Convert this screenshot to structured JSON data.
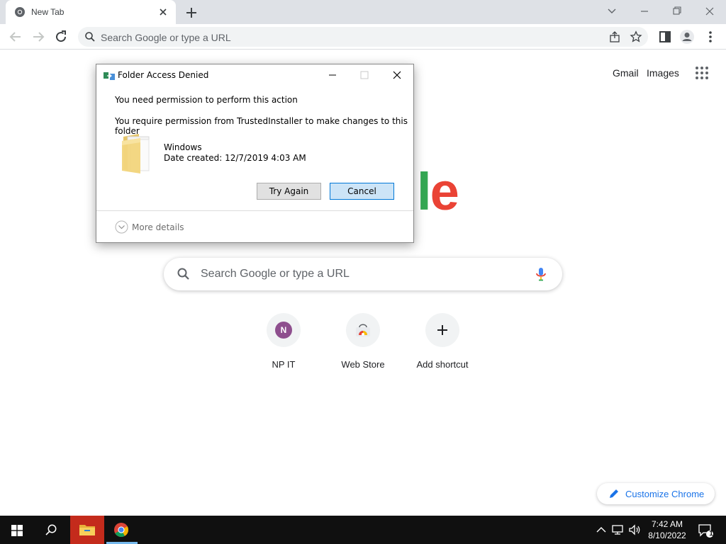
{
  "browser": {
    "tab_title": "New Tab",
    "omnibox_placeholder": "Search Google or type a URL"
  },
  "page": {
    "top_links": [
      "Gmail",
      "Images"
    ],
    "logo_visible_letters": [
      "l",
      "e"
    ],
    "search_placeholder": "Search Google or type a URL",
    "shortcuts": [
      {
        "label": "NP IT",
        "avatar_letter": "N",
        "icon": "avatar-icon"
      },
      {
        "label": "Web Store",
        "icon": "web-store-icon"
      },
      {
        "label": "Add shortcut",
        "icon": "plus-icon"
      }
    ],
    "customize_label": "Customize Chrome"
  },
  "dialog": {
    "title": "Folder Access Denied",
    "message_1": "You need permission to perform this action",
    "message_2": "You require permission from TrustedInstaller to make changes to this folder",
    "folder_name": "Windows",
    "folder_date": "Date created: 12/7/2019 4:03 AM",
    "try_again_label": "Try Again",
    "cancel_label": "Cancel",
    "more_details_label": "More details"
  },
  "taskbar": {
    "time": "7:42 AM",
    "date": "8/10/2022",
    "notification_count": "1"
  },
  "colors": {
    "google_green": "#34a853",
    "google_red": "#ea4335",
    "accent_blue": "#1a73e8",
    "taskbar_active": "#c42b1c",
    "dialog_primary_button": "#cce4f7"
  }
}
